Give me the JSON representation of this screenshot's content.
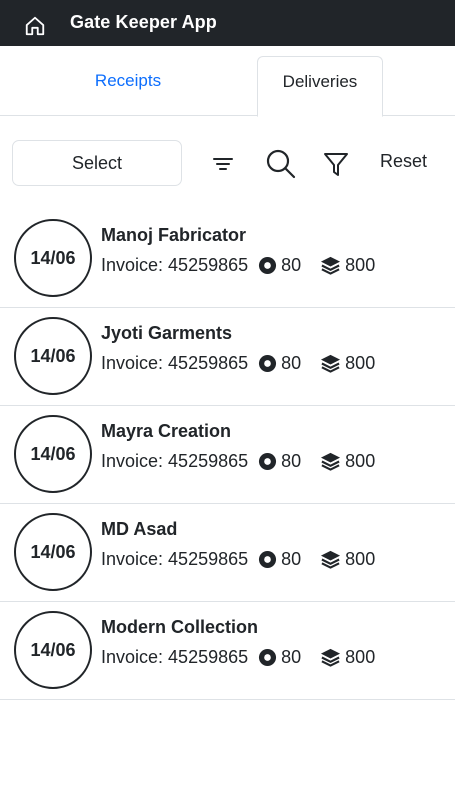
{
  "header": {
    "title": "Gate Keeper App",
    "home_icon": "home-icon",
    "background": "#212529"
  },
  "tabs": [
    {
      "label": "Receipts",
      "active": false,
      "color": "#0d6efd"
    },
    {
      "label": "Deliveries",
      "active": true
    }
  ],
  "toolbar": {
    "select_label": "Select",
    "sort_icon": "sort-lines-icon",
    "search_icon": "search-icon",
    "filter_icon": "funnel-icon",
    "reset_label": "Reset"
  },
  "entries": [
    {
      "date": "14/06",
      "name": "Manoj Fabricator",
      "invoice_label": "Invoice:",
      "invoice": "45259865",
      "count": "80",
      "quantity": "800"
    },
    {
      "date": "14/06",
      "name": "Jyoti Garments",
      "invoice_label": "Invoice:",
      "invoice": "45259865",
      "count": "80",
      "quantity": "800"
    },
    {
      "date": "14/06",
      "name": "Mayra Creation",
      "invoice_label": "Invoice:",
      "invoice": "45259865",
      "count": "80",
      "quantity": "800"
    },
    {
      "date": "14/06",
      "name": "MD Asad",
      "invoice_label": "Invoice:",
      "invoice": "45259865",
      "count": "80",
      "quantity": "800"
    },
    {
      "date": "14/06",
      "name": "Modern Collection",
      "invoice_label": "Invoice:",
      "invoice": "45259865",
      "count": "80",
      "quantity": "800"
    }
  ]
}
